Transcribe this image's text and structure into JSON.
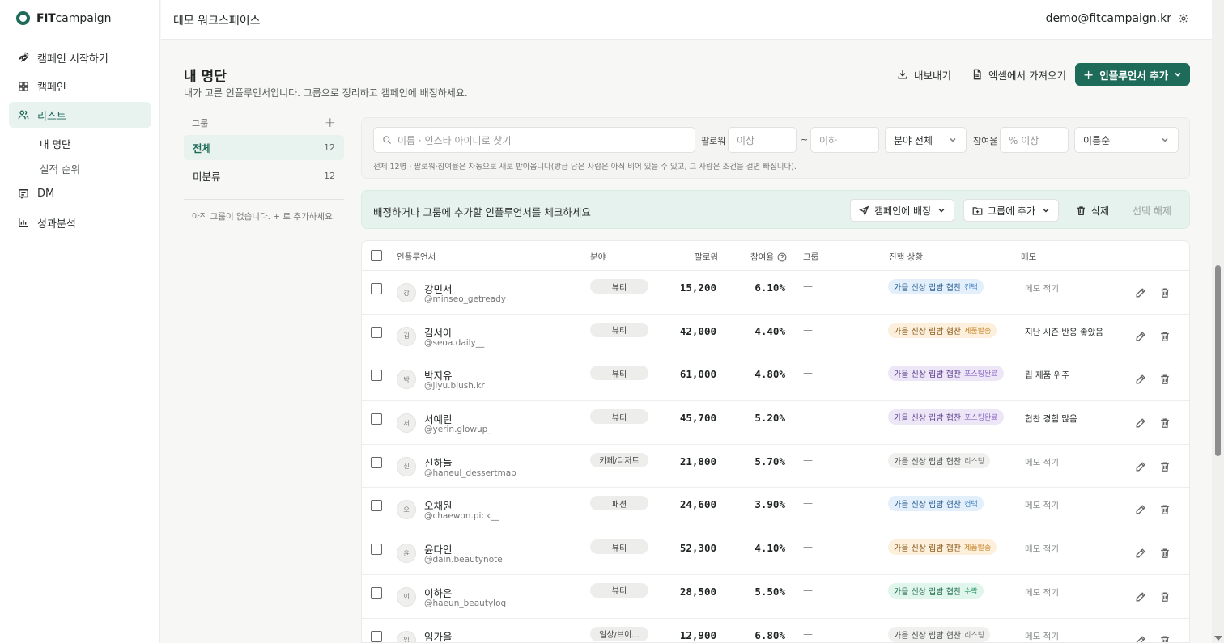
{
  "brand": {
    "bold": "FIT",
    "rest": "campaign"
  },
  "sidebar": {
    "items": [
      {
        "label": "캠페인 시작하기",
        "icon": "rocket-icon"
      },
      {
        "label": "캠페인",
        "icon": "grid-icon"
      },
      {
        "label": "리스트",
        "icon": "users-icon",
        "active": true
      },
      {
        "label": "DM",
        "icon": "message-icon"
      },
      {
        "label": "성과분석",
        "icon": "chart-icon"
      }
    ],
    "sub_items": [
      "내 명단",
      "실적 순위"
    ]
  },
  "topbar": {
    "workspace": "데모 워크스페이스",
    "user_email": "demo@fitcampaign.kr"
  },
  "header": {
    "title": "내 명단",
    "description": "내가 고른 인플루언서입니다. 그룹으로 정리하고 캠페인에 배정하세요.",
    "export_label": "내보내기",
    "import_label": "엑셀에서 가져오기",
    "add_label": "인플루언서 추가"
  },
  "groups": {
    "title": "그룹",
    "items": [
      {
        "label": "전체",
        "count": "12"
      },
      {
        "label": "미분류",
        "count": "12"
      }
    ],
    "empty_text": "아직 그룹이 없습니다. + 로 추가하세요."
  },
  "filters": {
    "search_placeholder": "이름 · 인스타 아이디로 찾기",
    "followers_label": "팔로워",
    "min_placeholder": "이상",
    "range_sep": "~",
    "max_placeholder": "이하",
    "category_value": "분야 전체",
    "engagement_label": "참여율",
    "engagement_placeholder": "% 이상",
    "sort_value": "이름순",
    "hint": "전체 12명 · 팔로워·참여율은 자동으로 새로 받아옵니다(방금 담은 사람은 아직 비어 있을 수 있고, 그 사람은 조건을 걸면 빠집니다)."
  },
  "action_bar": {
    "text": "배정하거나 그룹에 추가할 인플루언서를 체크하세요",
    "assign_label": "캠페인에 배정",
    "add_group_label": "그룹에 추가",
    "delete_label": "삭제",
    "clear_label": "선택 해제"
  },
  "table": {
    "columns": {
      "influencer": "인플루언서",
      "category": "분야",
      "followers": "팔로워",
      "engagement": "참여율",
      "group": "그룹",
      "status": "진행 상황",
      "memo": "메모"
    },
    "rows": [
      {
        "initial": "강",
        "name": "강민서",
        "handle": "@minseo_getready",
        "category": "뷰티",
        "followers": "15,200",
        "engagement": "6.10%",
        "group": "—",
        "campaign": "가을 신상 립밤 협찬",
        "stage": "컨택",
        "tone": "blue",
        "memo": "메모 적기",
        "memo_filled": false
      },
      {
        "initial": "김",
        "name": "김서아",
        "handle": "@seoa.daily__",
        "category": "뷰티",
        "followers": "42,000",
        "engagement": "4.40%",
        "group": "—",
        "campaign": "가을 신상 립밤 협찬",
        "stage": "제품발송",
        "tone": "orange",
        "memo": "지난 시즌 반응 좋았음",
        "memo_filled": true
      },
      {
        "initial": "박",
        "name": "박지유",
        "handle": "@jiyu.blush.kr",
        "category": "뷰티",
        "followers": "61,000",
        "engagement": "4.80%",
        "group": "—",
        "campaign": "가을 신상 립밤 협찬",
        "stage": "포스팅완료",
        "tone": "purple",
        "memo": "립 제품 위주",
        "memo_filled": true
      },
      {
        "initial": "서",
        "name": "서예린",
        "handle": "@yerin.glowup_",
        "category": "뷰티",
        "followers": "45,700",
        "engagement": "5.20%",
        "group": "—",
        "campaign": "가을 신상 립밤 협찬",
        "stage": "포스팅완료",
        "tone": "purple",
        "memo": "협찬 경험 많음",
        "memo_filled": true
      },
      {
        "initial": "신",
        "name": "신하늘",
        "handle": "@haneul_dessertmap",
        "category": "카페/디저트",
        "followers": "21,800",
        "engagement": "5.70%",
        "group": "—",
        "campaign": "가을 신상 립밤 협찬",
        "stage": "리스팅",
        "tone": "gray",
        "memo": "메모 적기",
        "memo_filled": false
      },
      {
        "initial": "오",
        "name": "오채원",
        "handle": "@chaewon.pick__",
        "category": "패션",
        "followers": "24,600",
        "engagement": "3.90%",
        "group": "—",
        "campaign": "가을 신상 립밤 협찬",
        "stage": "컨택",
        "tone": "blue",
        "memo": "메모 적기",
        "memo_filled": false
      },
      {
        "initial": "윤",
        "name": "윤다인",
        "handle": "@dain.beautynote",
        "category": "뷰티",
        "followers": "52,300",
        "engagement": "4.10%",
        "group": "—",
        "campaign": "가을 신상 립밤 협찬",
        "stage": "제품발송",
        "tone": "orange",
        "memo": "메모 적기",
        "memo_filled": false
      },
      {
        "initial": "이",
        "name": "이하은",
        "handle": "@haeun_beautylog",
        "category": "뷰티",
        "followers": "28,500",
        "engagement": "5.50%",
        "group": "—",
        "campaign": "가을 신상 립밤 협찬",
        "stage": "수락",
        "tone": "green",
        "memo": "메모 적기",
        "memo_filled": false
      },
      {
        "initial": "임",
        "name": "임가을",
        "handle": "",
        "category": "일상/브이...",
        "followers": "12,900",
        "engagement": "6.80%",
        "group": "—",
        "campaign": "가을 신상 립밤 협찬",
        "stage": "리스팅",
        "tone": "gray",
        "memo": "메모 적기",
        "memo_filled": false
      }
    ]
  },
  "colors": {
    "accent": "#1f6b5a",
    "accent_soft": "#e8f2ee",
    "status_blue": "#e3f0fb",
    "status_orange": "#fcefdc",
    "status_purple": "#ede6f7",
    "status_gray": "#f0f0ee",
    "status_green": "#e0f5ec"
  }
}
